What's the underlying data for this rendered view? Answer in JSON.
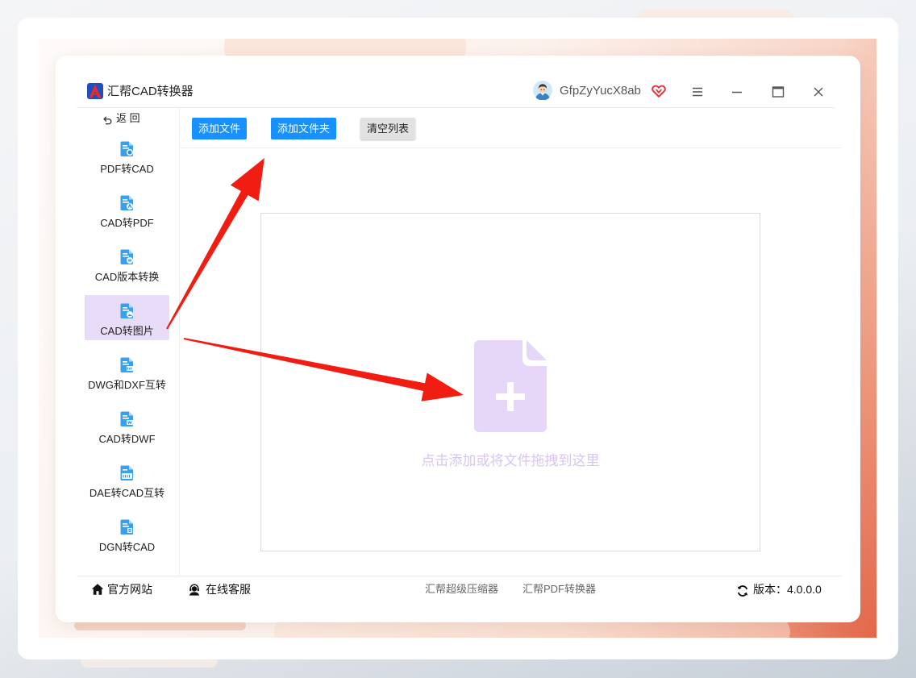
{
  "app": {
    "title": "汇帮CAD转换器",
    "logo_icon": "app-logo-icon"
  },
  "user": {
    "name": "GfpZyYucX8ab",
    "avatar_icon": "avatar-icon",
    "vip_icon": "vip-heart-icon"
  },
  "window_controls": {
    "menu_icon": "menu-icon",
    "minimize_icon": "minimize-icon",
    "maximize_icon": "maximize-icon",
    "close_icon": "close-icon"
  },
  "sidebar": {
    "back": {
      "label": "返 回",
      "icon": "back-arrow-icon"
    },
    "items": [
      {
        "label": "PDF转CAD",
        "icon": "pdf-to-cad-icon",
        "active": false
      },
      {
        "label": "CAD转PDF",
        "icon": "cad-to-pdf-icon",
        "active": false
      },
      {
        "label": "CAD版本转换",
        "icon": "cad-version-icon",
        "active": false
      },
      {
        "label": "CAD转图片",
        "icon": "cad-to-image-icon",
        "active": true
      },
      {
        "label": "DWG和DXF互转",
        "icon": "dwg-dxf-icon",
        "active": false
      },
      {
        "label": "CAD转DWF",
        "icon": "cad-to-dwf-icon",
        "active": false
      },
      {
        "label": "DAE转CAD互转",
        "icon": "dae-cad-icon",
        "active": false
      },
      {
        "label": "DGN转CAD",
        "icon": "dgn-to-cad-icon",
        "active": false
      }
    ]
  },
  "toolbar": {
    "add_file_label": "添加文件",
    "add_folder_label": "添加文件夹",
    "clear_list_label": "清空列表"
  },
  "dropzone": {
    "hint": "点击添加或将文件拖拽到这里",
    "icon": "add-file-icon"
  },
  "footer": {
    "website": {
      "label": "官方网站",
      "icon": "home-icon"
    },
    "support": {
      "label": "在线客服",
      "icon": "headset-icon"
    },
    "links": [
      {
        "label": "汇帮超级压缩器"
      },
      {
        "label": "汇帮PDF转换器"
      }
    ],
    "version": {
      "label": "版本：4.0.0.0",
      "icon": "refresh-icon"
    }
  },
  "theme": {
    "accent": "#1890ff",
    "active_bg": "#e8dcf9",
    "drop_icon": "#e6d6f8",
    "drop_text": "#d8c6ef",
    "annotation_arrow": "#f21d12"
  }
}
